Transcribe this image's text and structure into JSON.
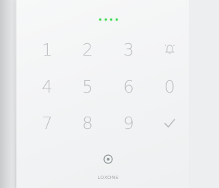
{
  "device": {
    "led_color": "#35d24a",
    "leds": 4,
    "brand": "LOXONE"
  },
  "keys": {
    "k1": "1",
    "k2": "2",
    "k3": "3",
    "k4": "4",
    "k5": "5",
    "k6": "6",
    "k0": "0",
    "k7": "7",
    "k8": "8",
    "k9": "9"
  },
  "icons": {
    "bell": "bell-icon",
    "check": "checkmark-icon",
    "fingerprint": "target-icon"
  }
}
